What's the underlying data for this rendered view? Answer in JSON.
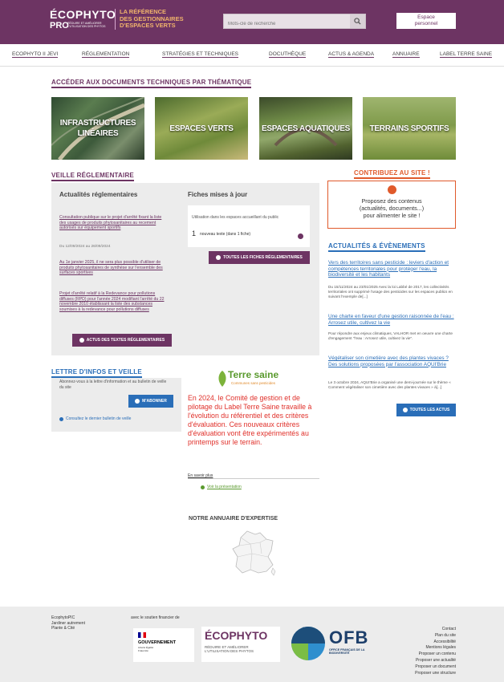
{
  "header": {
    "logo_line1": "ÉCOPHYTO",
    "logo_line2": "PRO",
    "logo_sub": "RÉDUIRE ET AMÉLIORER L'UTILISATION DES PHYTOS",
    "tagline_1": "LA RÉFÉRENCE",
    "tagline_2": "DES GESTIONNAIRES",
    "tagline_3": "D'ESPACES VERTS",
    "search_placeholder": "Mots-clé de recherche",
    "espace_1": "Espace",
    "espace_2": "personnel"
  },
  "nav": [
    "ECOPHYTO II JEVI",
    "RÉGLEMENTATION",
    "STRATÉGIES ET TECHNIQUES",
    "DOCUTHÈQUE",
    "ACTUS & AGENDA",
    "ANNUAIRE",
    "LABEL TERRE SAINE"
  ],
  "themes": {
    "title": "ACCÉDER AUX DOCUMENTS TECHNIQUES PAR THÉMATIQUE",
    "tiles": [
      "INFRASTRUCTURES LINÉAIRES",
      "ESPACES VERTS",
      "ESPACES AQUATIQUES",
      "TERRAINS SPORTIFS"
    ]
  },
  "veille": {
    "title": "VEILLE RÉGLEMENTAIRE",
    "actus_title": "Actualités réglementaires",
    "actus": [
      {
        "text": "Consultation publique sur le projet d'arrêté fixant la liste des usages de produits phytosanitaires au recement autorisés sur équipement sportifs",
        "date": "Du 12/09/2024 au 26/09/2024"
      },
      {
        "text": "Au 1e janvier 2025, il ne sera plus possible d'utiliser de produits phytosanitaires de synthèse sur l'ensemble des surfaces sportives",
        "date": ""
      },
      {
        "text": "Projet d'arrêté relatif à la Redevance pour pollutions diffuses (RPD) pour l'année 2024 modifiant l'arrêté du 22 novembre 2010 établissant la liste des substances soumises à la redevance pour pollutions diffuses",
        "date": ""
      }
    ],
    "actus_button": "ACTUS DES TEXTES RÉGLEMENTAIRES",
    "fiches_title": "Fiches mises à jour",
    "fiches_text": "Utilisation dans les espaces accueillant du public",
    "fiches_count": "1",
    "fiches_count_text": "nouveau texte (dans 1 fiche)",
    "fiches_button": "TOUTES LES FICHES RÉGLEMENTAIRES"
  },
  "contribuez": {
    "title": "CONTRIBUEZ AU SITE !",
    "text_1": "Proposez des contenus",
    "text_2": "(actualités, documents...)",
    "text_3": "pour alimenter le site !"
  },
  "events": {
    "title": "ACTUALITÉS & ÉVÈNEMENTS",
    "items": [
      {
        "title": "Vers des territoires sans pesticide : leviers d'action et compétences territoriales pour protéger l'eau, la biodiversité et les habitants",
        "text": "Du 15/11/2024 au 23/01/2025 Avec la loi Labbé de 2017, les collectivités territoriales ont supprimé l'usage des pesticides sur les espaces publics en suivant l'exemple de[...]"
      },
      {
        "title": "Une charte en faveur d'une gestion raisonnée de l'eau : Arrosez utile, cultivez la vie",
        "text": "Pour répondre aux enjeux climatiques, VALHOR met en oeuvre une charte d'engagement \"l'eau : Arrosez utile, cultivez la vie\"."
      },
      {
        "title": "Végétaliser son cimetière avec des plantes vivaces ? Des solutions proposées par l'association AQUI'Brie",
        "text": "Le 3 octobre 2024, AQUI'Brie a organisé une demi-journée sur le thème « Comment végétaliser son cimetière avec des plantes vivaces » à[...]"
      }
    ],
    "button": "TOUTES LES ACTUS"
  },
  "newsletter": {
    "title": "LETTRE D'INFOS ET VEILLE",
    "text": "Abonnez-vous à la lettre d'information et au bulletin de veille du site",
    "button": "M'ABONNER",
    "link": "Consultez le dernier bulletin de veille"
  },
  "terre_saine": {
    "logo_1": "Terre saine",
    "logo_2": "Communes sans pesticides",
    "text": "En 2024, le Comité de gestion et de pilotage du Label Terre Saine travaille à l'évolution du référentiel et des critères d'évaluation. Ces nouveaux critères d'évaluation vont être expérimentés au printemps sur le terrain.",
    "more": "En savoir plus",
    "presentation": "Voir la présentation"
  },
  "annuaire": {
    "title": "NOTRE ANNUAIRE D'EXPERTISE"
  },
  "footer": {
    "left_1": "EcophytoPIC",
    "left_2": "Jardiner autrement",
    "left_3": "Plante & Cité",
    "support": "avec le soutien financier de",
    "gouv": "GOUVERNEMENT",
    "gouv_sub": "Liberté Égalité Fraternité",
    "eco_1": "ÉCOPHYTO",
    "eco_2": "RÉDUIRE ET AMÉLIORER",
    "eco_3": "L'UTILISATION DES PHYTOS",
    "ofb": "OFB",
    "ofb_sub": "OFFICE FRANÇAIS DE LA BIODIVERSITÉ",
    "links": [
      "Contact",
      "Plan du site",
      "Accessibilité",
      "Mentions légales",
      "Proposer un contenu",
      "Proposer une actualité",
      "Proposer un document",
      "Proposer une structure"
    ]
  }
}
